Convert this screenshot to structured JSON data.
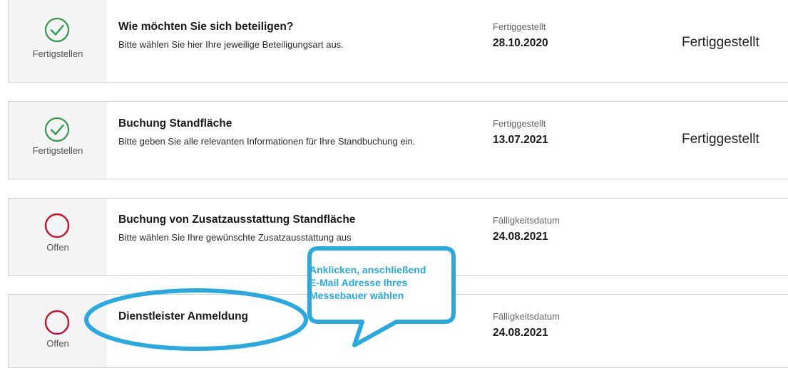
{
  "tasks": [
    {
      "status": "Fertigstellen",
      "title": "Wie möchten Sie sich beteiligen?",
      "description": "Bitte wählen Sie hier Ihre jeweilige Beteiligungsart aus.",
      "date_label": "Fertiggestellt",
      "date_value": "28.10.2020",
      "state": "Fertiggestellt"
    },
    {
      "status": "Fertigstellen",
      "title": "Buchung Standfläche",
      "description": "Bitte geben Sie alle relevanten Informationen für Ihre Standbuchung ein.",
      "date_label": "Fertiggestellt",
      "date_value": "13.07.2021",
      "state": "Fertiggestellt"
    },
    {
      "status": "Offen",
      "title": "Buchung von Zusatzausstattung Standfläche",
      "description": "Bitte wählen Sie Ihre gewünschte Zusatzausstattung aus",
      "date_label": "Fälligkeitsdatum",
      "date_value": "24.08.2021"
    },
    {
      "status": "Offen",
      "title": "Dienstleister Anmeldung",
      "date_label": "Fälligkeitsdatum",
      "date_value": "24.08.2021"
    }
  ],
  "callout": {
    "line1": "Anklicken, anschließend",
    "line2": "E-Mail Adresse Ihres",
    "line3": "Messebauer wählen"
  },
  "colors": {
    "done_green": "#2e9b4f",
    "open_red": "#c8102e",
    "annotation_blue": "#29a9e1",
    "status_bg": "#f4f4f4"
  },
  "icons": {
    "done": "check-circle-icon",
    "open": "open-circle-icon"
  }
}
